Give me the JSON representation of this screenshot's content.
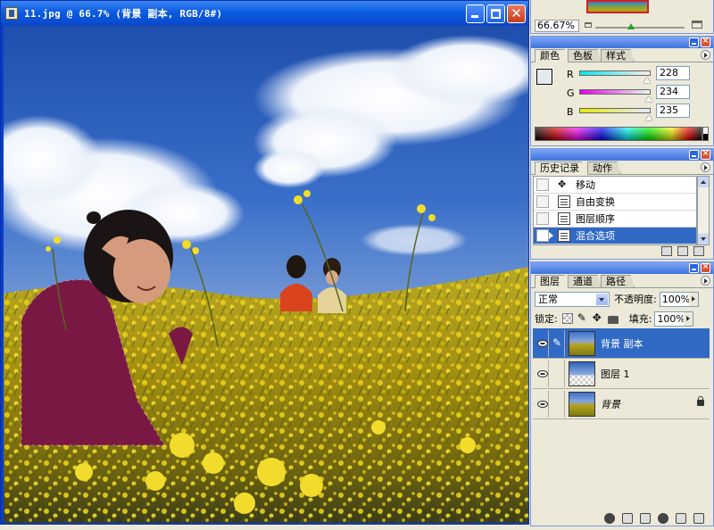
{
  "document": {
    "title": "11.jpg @ 66.7% (背景 副本, RGB/8#)"
  },
  "navigator": {
    "zoom": "66.67%"
  },
  "color_panel": {
    "tabs": [
      "颜色",
      "色板",
      "样式"
    ],
    "active_tab": "颜色",
    "foreground_color": "#e4eaeb",
    "channels": [
      {
        "label": "R",
        "value": "228"
      },
      {
        "label": "G",
        "value": "234"
      },
      {
        "label": "B",
        "value": "235"
      }
    ]
  },
  "history_panel": {
    "tabs": [
      "历史记录",
      "动作"
    ],
    "items": [
      {
        "label": "移动",
        "icon": "move-icon"
      },
      {
        "label": "自由变换",
        "icon": "history-state-icon"
      },
      {
        "label": "图层顺序",
        "icon": "history-state-icon"
      },
      {
        "label": "混合选项",
        "icon": "history-state-icon",
        "selected": true
      }
    ]
  },
  "layers_panel": {
    "tabs": [
      "图层",
      "通道",
      "路径"
    ],
    "blend_mode": "正常",
    "opacity_label": "不透明度:",
    "opacity": "100%",
    "lock_label": "锁定:",
    "fill_label": "填充:",
    "fill": "100%",
    "layers": [
      {
        "name": "背景 副本",
        "selected": true,
        "visible": true,
        "thumbnail": "photo"
      },
      {
        "name": "图层 1",
        "selected": false,
        "visible": true,
        "thumbnail": "sky"
      },
      {
        "name": "背景",
        "selected": false,
        "visible": true,
        "thumbnail": "photo",
        "locked": true,
        "italic": true
      }
    ]
  },
  "colors": {
    "titlebar": "#0b5be0",
    "selection": "#316ac5",
    "panel_bg": "#ece9d8"
  }
}
